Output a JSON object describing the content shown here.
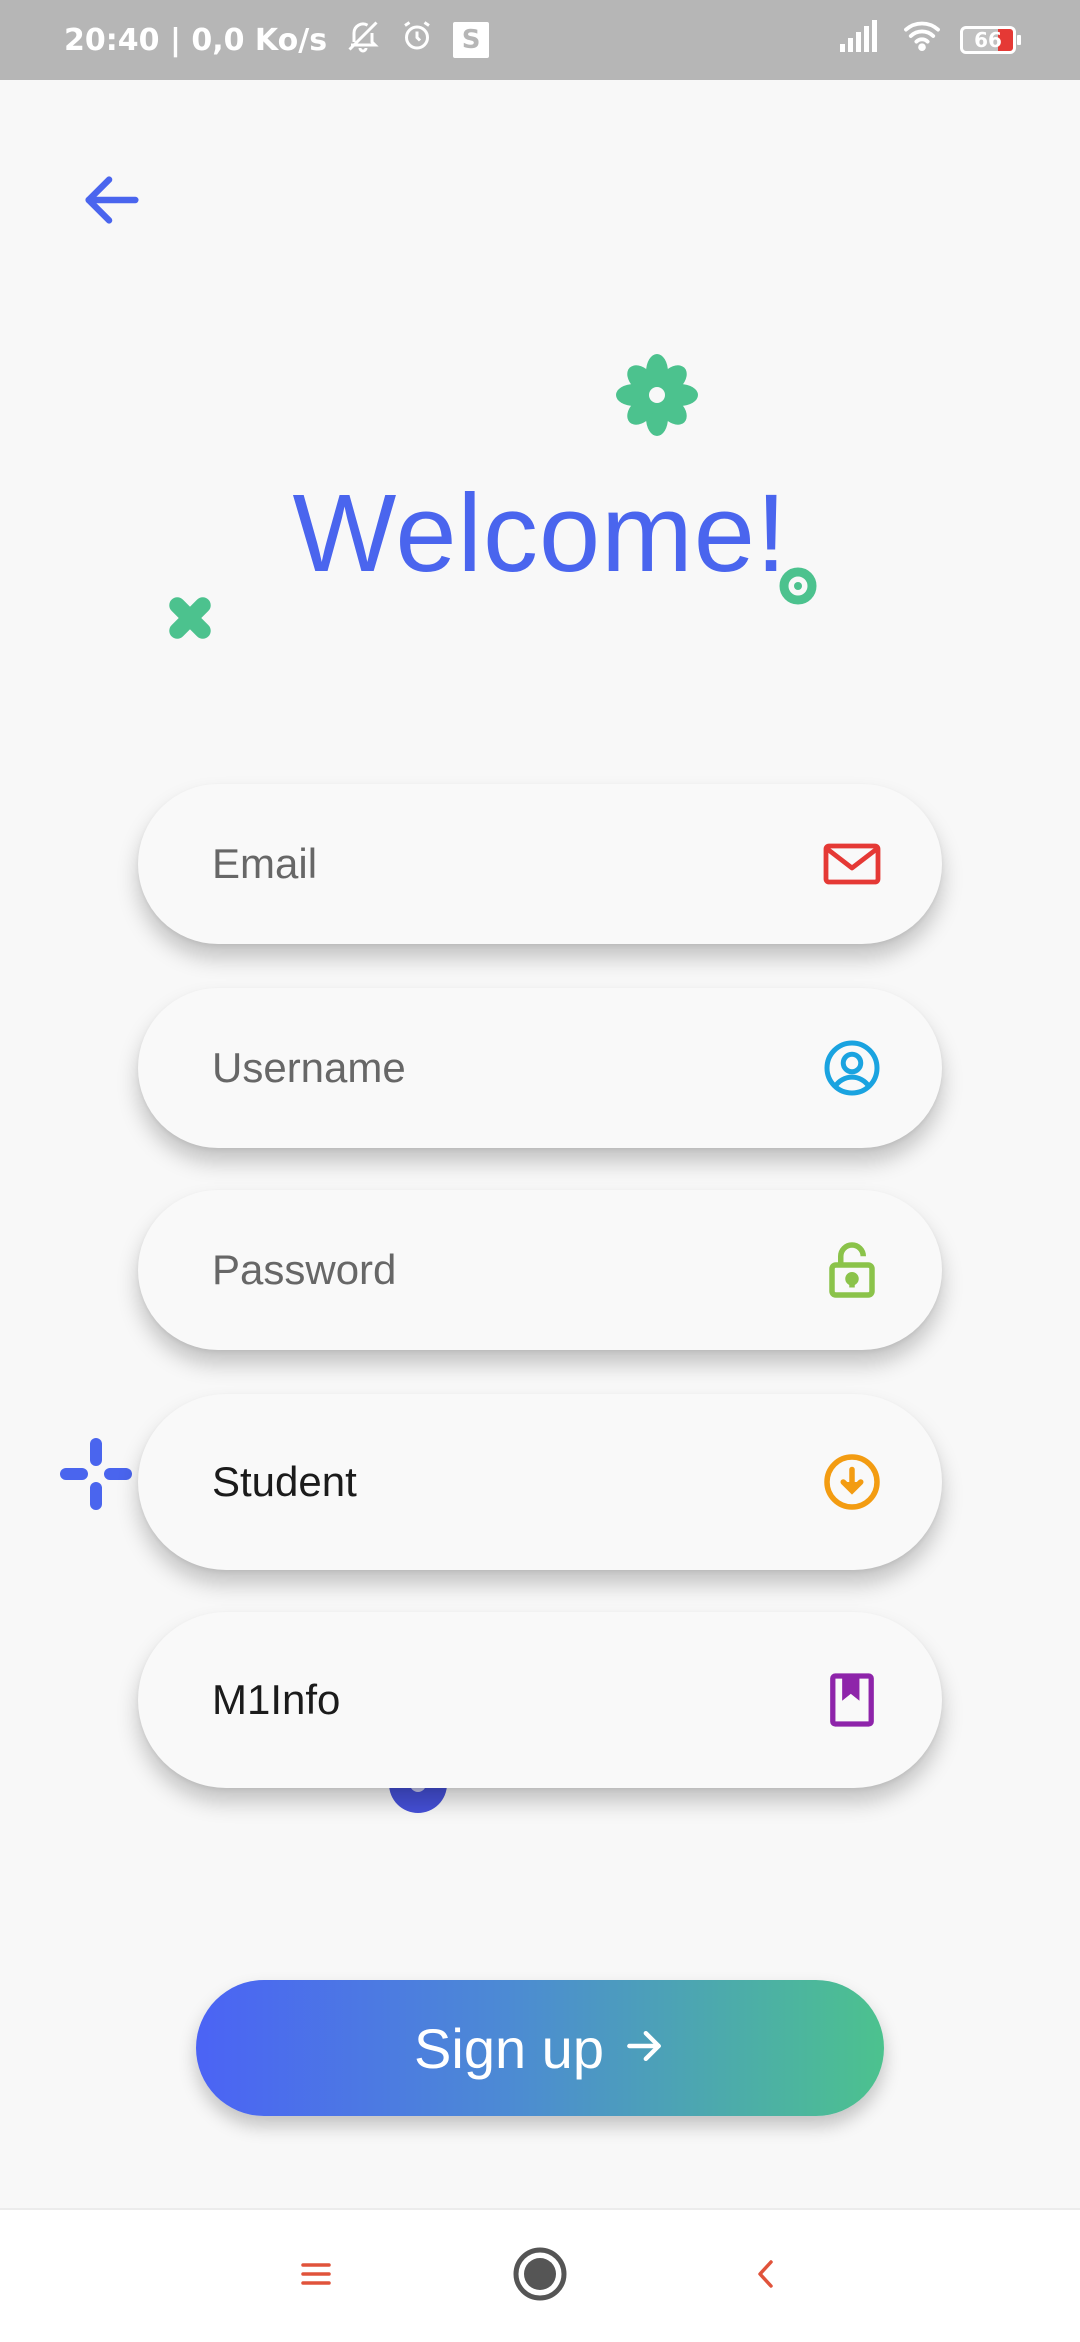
{
  "status_bar": {
    "time_speed": "20:40 | 0,0 Ko/s",
    "s_label": "S",
    "battery": "66"
  },
  "title": "Welcome!",
  "form": {
    "email_placeholder": "Email",
    "username_placeholder": "Username",
    "password_placeholder": "Password",
    "role_value": "Student",
    "program_value": "M1Info"
  },
  "signup_label": "Sign up",
  "colors": {
    "primary": "#4a65ee",
    "accent_green": "#4cc28e",
    "email_icon": "#e53935",
    "username_icon": "#1aa3e0",
    "password_icon": "#8bc34a",
    "role_icon": "#f39c12",
    "program_icon": "#8e24aa",
    "nav_icons": "#e0533b"
  },
  "icons": {
    "back": "arrow-left-icon",
    "email": "mail-icon",
    "username": "user-circle-icon",
    "password": "lock-icon",
    "role": "download-circle-icon",
    "program": "bookmark-icon",
    "signup": "arrow-right-icon"
  }
}
